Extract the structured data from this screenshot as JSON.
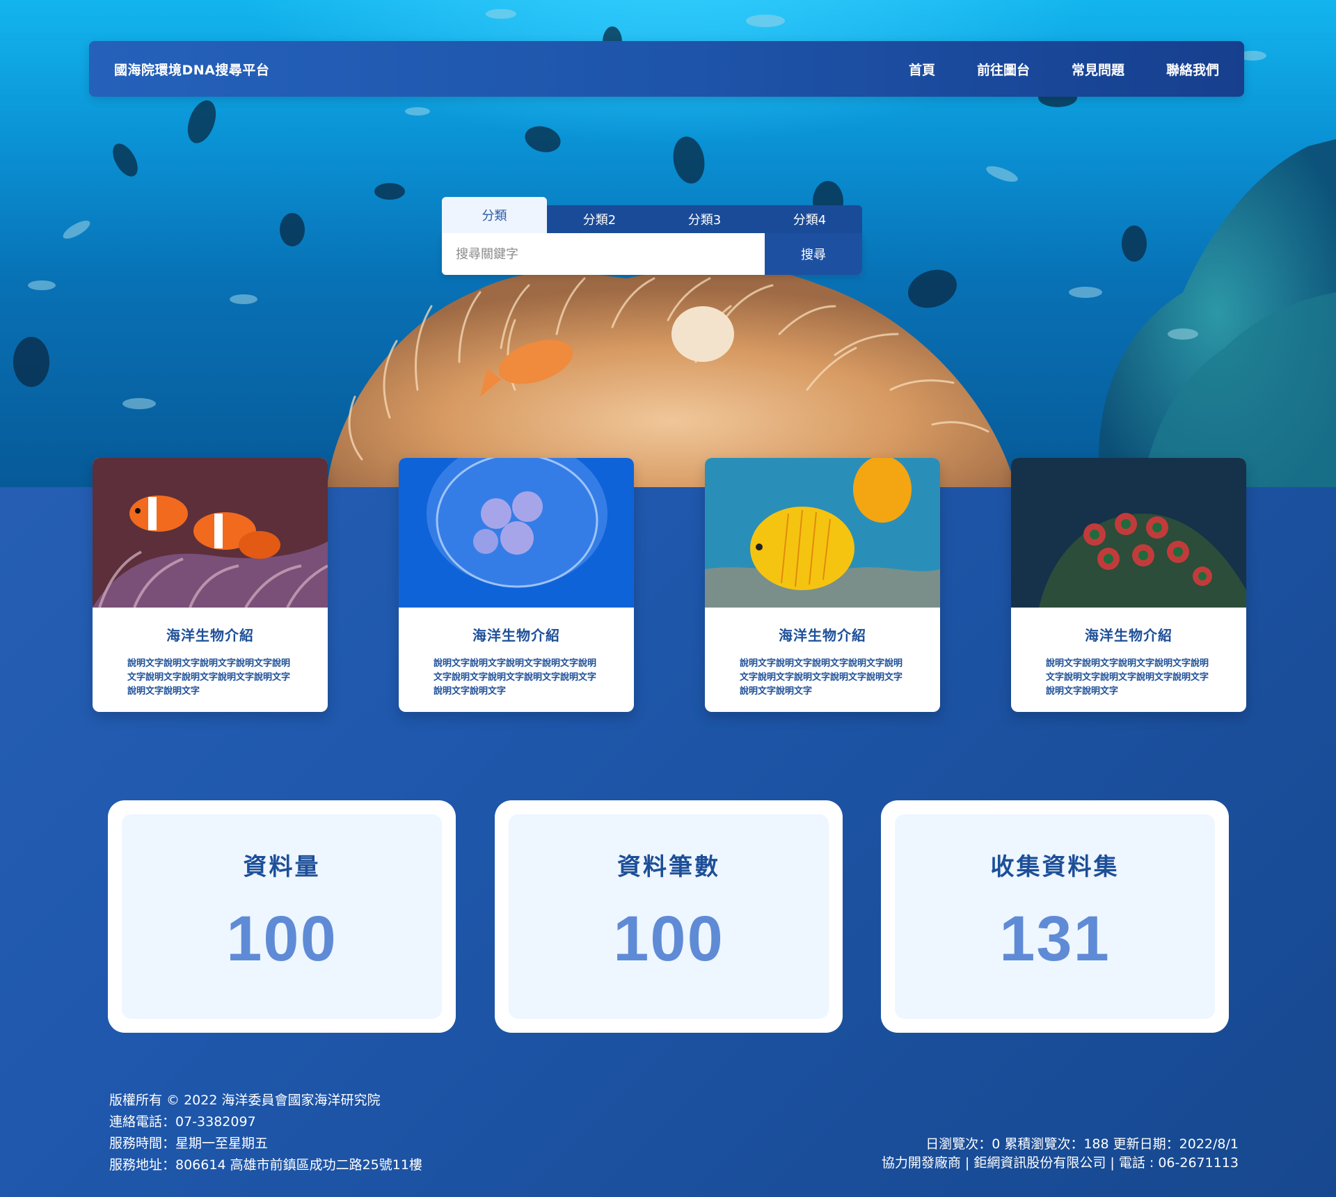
{
  "header": {
    "brand": "國海院環境DNA搜尋平台",
    "nav": [
      "首頁",
      "前往圖台",
      "常見問題",
      "聯絡我們"
    ]
  },
  "search": {
    "tabs": [
      "分類",
      "分類2",
      "分類3",
      "分類4"
    ],
    "placeholder": "搜尋關鍵字",
    "button": "搜尋"
  },
  "cards": [
    {
      "image": "clownfish-anemone-photo",
      "title": "海洋生物介紹",
      "desc": "說明文字說明文字說明文字說明文字說明文字說明文字說明文字說明文字說明文字說明文字說明文字"
    },
    {
      "image": "jellyfish-photo",
      "title": "海洋生物介紹",
      "desc": "說明文字說明文字說明文字說明文字說明文字說明文字說明文字說明文字說明文字說明文字說明文字"
    },
    {
      "image": "yellow-butterflyfish-photo",
      "title": "海洋生物介紹",
      "desc": "說明文字說明文字說明文字說明文字說明文字說明文字說明文字說明文字說明文字說明文字說明文字"
    },
    {
      "image": "coral-polyps-photo",
      "title": "海洋生物介紹",
      "desc": "說明文字說明文字說明文字說明文字說明文字說明文字說明文字說明文字說明文字說明文字說明文字"
    }
  ],
  "stats": [
    {
      "label": "資料量",
      "value": "100"
    },
    {
      "label": "資料筆數",
      "value": "100"
    },
    {
      "label": "收集資料集",
      "value": "131"
    }
  ],
  "footer": {
    "copyright": "版權所有 © 2022 海洋委員會國家海洋研究院",
    "phone": "連絡電話：07-3382097",
    "hours": "服務時間：星期一至星期五",
    "address": "服務地址：806614 高雄市前鎮區成功二路25號11樓",
    "stats_line": "日瀏覽次：0 累積瀏覽次：188 更新日期：2022/8/1",
    "vendor_line": "協力開發廠商 | 鉅網資訊股份有限公司 | 電話 : 06-2671113"
  },
  "colors": {
    "primary": "#1e50a2",
    "stat_number": "#5f8bd6",
    "ocean": "#0a93d6"
  }
}
